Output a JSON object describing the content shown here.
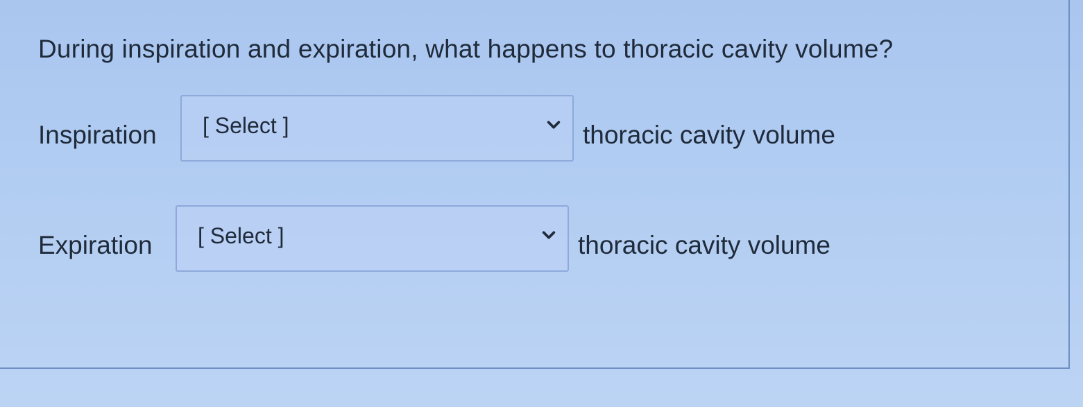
{
  "question": "During inspiration and expiration, what happens to thoracic cavity volume?",
  "rows": [
    {
      "label": "Inspiration",
      "select_value": "[ Select ]",
      "suffix": "thoracic cavity volume"
    },
    {
      "label": "Expiration",
      "select_value": "[ Select ]",
      "suffix": "thoracic cavity volume"
    }
  ],
  "icons": {
    "dropdown": "chevron-down-icon"
  },
  "colors": {
    "background": "#b2cdf2",
    "border": "#8eaadb",
    "text": "#1f2a3a"
  }
}
